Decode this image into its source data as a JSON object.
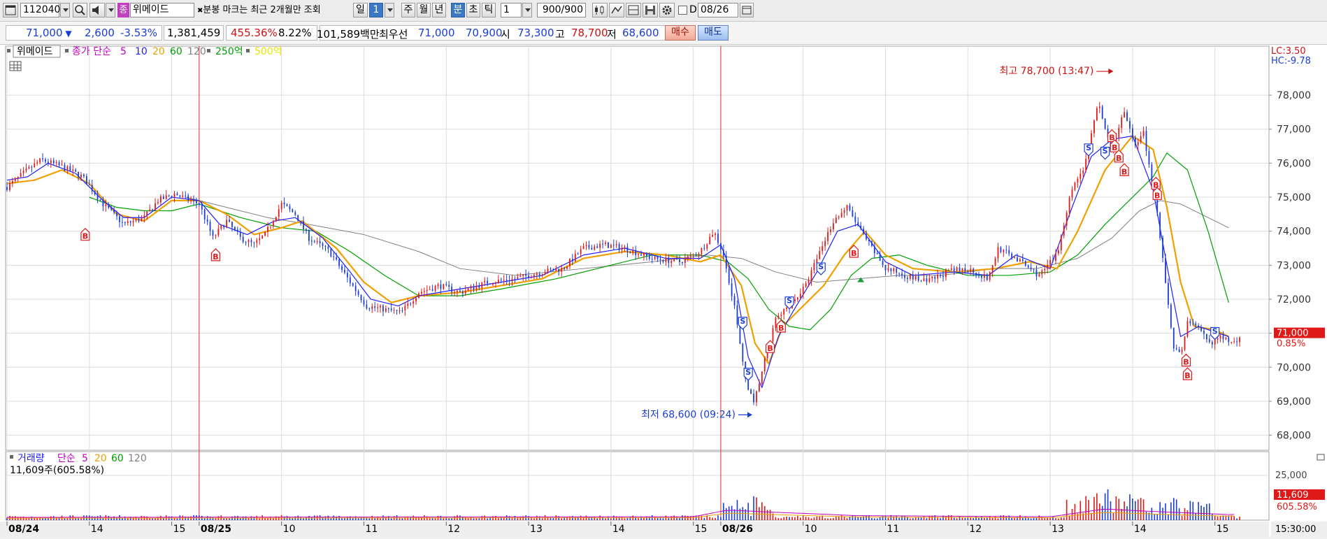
{
  "toolbar": {
    "code": "112040",
    "stock_badge": "종",
    "stock_name": "위메이드",
    "notice": "분봉 마크는 최근 2개월만 조회",
    "period_day": "일",
    "period_num": "1",
    "period_week": "주",
    "period_month": "월",
    "period_year": "년",
    "period_minute": "분",
    "period_second": "초",
    "period_tick": "틱",
    "interval": "1",
    "count": "900/900",
    "d_label": "D",
    "date": "08/26"
  },
  "price_bar": {
    "price": "71,000",
    "change": "2,600",
    "change_pct": "-3.53%",
    "volume": "1,381,459",
    "volume_ratio": "455.36%",
    "turnover": "8.22%",
    "amount": "101,589백만",
    "best_bid_label": "최우선",
    "ask": "71,000",
    "bid": "70,900",
    "open_label": "시",
    "open": "73,300",
    "high_label": "고",
    "high": "78,700",
    "low_label": "저",
    "low": "68,600",
    "buy_button": "매수",
    "sell_button": "매도"
  },
  "legend": {
    "name": "위메이드",
    "price_label": "종가 단순",
    "ma": [
      "5",
      "10",
      "20",
      "60",
      "120"
    ],
    "ma_colors": [
      "#d000d0",
      "#2020ff",
      "#f0a000",
      "#00a000",
      "#808080"
    ],
    "extra1": "250억",
    "extra1_color": "#00a000",
    "extra2": "500억",
    "extra2_color": "#e6e600"
  },
  "vol_legend": {
    "name": "거래량",
    "label": "단순",
    "ma": [
      "5",
      "20",
      "60",
      "120"
    ],
    "ma_colors": [
      "#d000d0",
      "#f0a000",
      "#00a000",
      "#808080"
    ],
    "value": "11,609주(605.58%)"
  },
  "annotations": {
    "high": "최고 78,700 (13:47)",
    "low": "최저 68,600 (09:24)"
  },
  "right_labels": {
    "lc": "LC:3.50",
    "hc": "HC:-9.78",
    "last_price": "71,000",
    "last_pct": "0.85%",
    "vol_last": "11,609",
    "vol_pct": "605.58%",
    "vol_tick": "25,000",
    "time": "15:30:00"
  },
  "chart_data": {
    "type": "candlestick",
    "title": "위메이드",
    "ylim": [
      67600,
      79400
    ],
    "y_ticks": [
      68000,
      69000,
      70000,
      71000,
      72000,
      73000,
      74000,
      75000,
      76000,
      77000,
      78000
    ],
    "y_tick_labels": [
      "68,000",
      "69,000",
      "70,000",
      "71,000",
      "72,000",
      "73,000",
      "74,000",
      "75,000",
      "76,000",
      "77,000",
      "78,000"
    ],
    "x_labels": [
      "08/24",
      "14",
      "15",
      "08/25",
      "10",
      "11",
      "12",
      "13",
      "14",
      "15",
      "08/26",
      "10",
      "11",
      "12",
      "13",
      "14",
      "15"
    ],
    "x_bold": [
      true,
      false,
      false,
      true,
      false,
      false,
      false,
      false,
      false,
      false,
      true,
      false,
      false,
      false,
      false,
      false,
      false
    ],
    "x_label_index": [
      0,
      60,
      120,
      140,
      200,
      260,
      320,
      380,
      440,
      500,
      520,
      580,
      640,
      700,
      760,
      820,
      880
    ],
    "day_separators_index": [
      140,
      520
    ],
    "total_bars": 900,
    "price_path": [
      [
        0,
        75300
      ],
      [
        15,
        75800
      ],
      [
        25,
        76100
      ],
      [
        40,
        75900
      ],
      [
        55,
        75600
      ],
      [
        70,
        74800
      ],
      [
        85,
        74200
      ],
      [
        100,
        74400
      ],
      [
        110,
        74900
      ],
      [
        122,
        75100
      ],
      [
        140,
        74800
      ],
      [
        150,
        73800
      ],
      [
        160,
        74300
      ],
      [
        170,
        73800
      ],
      [
        180,
        73600
      ],
      [
        188,
        73900
      ],
      [
        200,
        74800
      ],
      [
        210,
        74500
      ],
      [
        220,
        73800
      ],
      [
        235,
        73400
      ],
      [
        250,
        72500
      ],
      [
        262,
        71800
      ],
      [
        275,
        71700
      ],
      [
        287,
        71600
      ],
      [
        300,
        72200
      ],
      [
        315,
        72400
      ],
      [
        330,
        72200
      ],
      [
        350,
        72500
      ],
      [
        370,
        72600
      ],
      [
        390,
        72800
      ],
      [
        405,
        72900
      ],
      [
        420,
        73500
      ],
      [
        435,
        73600
      ],
      [
        450,
        73500
      ],
      [
        470,
        73200
      ],
      [
        490,
        73100
      ],
      [
        505,
        73400
      ],
      [
        515,
        74000
      ],
      [
        522,
        73300
      ],
      [
        530,
        71800
      ],
      [
        537,
        69800
      ],
      [
        544,
        68900
      ],
      [
        552,
        70200
      ],
      [
        560,
        71400
      ],
      [
        572,
        71900
      ],
      [
        582,
        72400
      ],
      [
        592,
        73400
      ],
      [
        602,
        74300
      ],
      [
        612,
        74700
      ],
      [
        625,
        73800
      ],
      [
        640,
        72900
      ],
      [
        655,
        72700
      ],
      [
        670,
        72500
      ],
      [
        685,
        72800
      ],
      [
        700,
        72900
      ],
      [
        715,
        72600
      ],
      [
        722,
        73500
      ],
      [
        735,
        73200
      ],
      [
        752,
        72700
      ],
      [
        765,
        73300
      ],
      [
        775,
        75200
      ],
      [
        785,
        75900
      ],
      [
        795,
        77800
      ],
      [
        805,
        76200
      ],
      [
        813,
        77600
      ],
      [
        822,
        76500
      ],
      [
        828,
        76900
      ],
      [
        838,
        74500
      ],
      [
        844,
        72500
      ],
      [
        850,
        70600
      ],
      [
        855,
        70300
      ],
      [
        860,
        71400
      ],
      [
        868,
        71100
      ],
      [
        876,
        70700
      ],
      [
        884,
        70900
      ],
      [
        890,
        70800
      ]
    ],
    "ma5_path": [
      [
        0,
        75500
      ],
      [
        15,
        75600
      ],
      [
        30,
        76000
      ],
      [
        50,
        75700
      ],
      [
        70,
        74900
      ],
      [
        85,
        74400
      ],
      [
        100,
        74400
      ],
      [
        120,
        75000
      ],
      [
        140,
        74900
      ],
      [
        155,
        74200
      ],
      [
        175,
        73900
      ],
      [
        195,
        74300
      ],
      [
        210,
        74400
      ],
      [
        230,
        73800
      ],
      [
        250,
        72800
      ],
      [
        265,
        72000
      ],
      [
        285,
        71800
      ],
      [
        300,
        72100
      ],
      [
        330,
        72300
      ],
      [
        360,
        72500
      ],
      [
        390,
        72700
      ],
      [
        420,
        73300
      ],
      [
        450,
        73500
      ],
      [
        480,
        73200
      ],
      [
        505,
        73200
      ],
      [
        520,
        73600
      ],
      [
        530,
        72600
      ],
      [
        540,
        70300
      ],
      [
        550,
        69400
      ],
      [
        562,
        70900
      ],
      [
        575,
        71800
      ],
      [
        590,
        72800
      ],
      [
        605,
        74000
      ],
      [
        620,
        74200
      ],
      [
        640,
        73100
      ],
      [
        660,
        72700
      ],
      [
        690,
        72800
      ],
      [
        715,
        72700
      ],
      [
        735,
        73300
      ],
      [
        760,
        72900
      ],
      [
        775,
        74600
      ],
      [
        790,
        76200
      ],
      [
        805,
        76700
      ],
      [
        820,
        76800
      ],
      [
        835,
        75200
      ],
      [
        845,
        73000
      ],
      [
        855,
        70900
      ],
      [
        868,
        71200
      ],
      [
        890,
        70900
      ]
    ],
    "ma20_path": [
      [
        0,
        75400
      ],
      [
        20,
        75500
      ],
      [
        40,
        75800
      ],
      [
        60,
        75400
      ],
      [
        80,
        74500
      ],
      [
        100,
        74300
      ],
      [
        120,
        74900
      ],
      [
        140,
        74900
      ],
      [
        160,
        74500
      ],
      [
        180,
        73900
      ],
      [
        200,
        74100
      ],
      [
        215,
        74300
      ],
      [
        240,
        73500
      ],
      [
        260,
        72500
      ],
      [
        280,
        71900
      ],
      [
        300,
        72100
      ],
      [
        330,
        72200
      ],
      [
        360,
        72400
      ],
      [
        390,
        72600
      ],
      [
        420,
        73200
      ],
      [
        450,
        73400
      ],
      [
        480,
        73300
      ],
      [
        505,
        73100
      ],
      [
        520,
        73300
      ],
      [
        535,
        72400
      ],
      [
        545,
        70700
      ],
      [
        555,
        70100
      ],
      [
        565,
        71200
      ],
      [
        580,
        71800
      ],
      [
        595,
        72400
      ],
      [
        610,
        73300
      ],
      [
        625,
        74000
      ],
      [
        640,
        73300
      ],
      [
        660,
        72900
      ],
      [
        690,
        72800
      ],
      [
        720,
        72900
      ],
      [
        745,
        73100
      ],
      [
        765,
        72900
      ],
      [
        780,
        74000
      ],
      [
        800,
        75800
      ],
      [
        820,
        76800
      ],
      [
        835,
        76400
      ],
      [
        845,
        74700
      ],
      [
        855,
        72500
      ],
      [
        865,
        71200
      ],
      [
        880,
        71100
      ],
      [
        890,
        70900
      ]
    ],
    "ma60_path": [
      [
        60,
        75000
      ],
      [
        80,
        74700
      ],
      [
        100,
        74600
      ],
      [
        120,
        74600
      ],
      [
        140,
        74800
      ],
      [
        170,
        74400
      ],
      [
        200,
        74100
      ],
      [
        225,
        74000
      ],
      [
        250,
        73400
      ],
      [
        275,
        72700
      ],
      [
        300,
        72100
      ],
      [
        330,
        72100
      ],
      [
        360,
        72300
      ],
      [
        400,
        72600
      ],
      [
        440,
        73000
      ],
      [
        470,
        73300
      ],
      [
        505,
        73300
      ],
      [
        525,
        73100
      ],
      [
        540,
        72600
      ],
      [
        555,
        71700
      ],
      [
        570,
        71200
      ],
      [
        585,
        71100
      ],
      [
        600,
        71700
      ],
      [
        615,
        72700
      ],
      [
        630,
        73200
      ],
      [
        650,
        73300
      ],
      [
        670,
        73000
      ],
      [
        700,
        72700
      ],
      [
        730,
        72700
      ],
      [
        760,
        72800
      ],
      [
        780,
        73300
      ],
      [
        800,
        74200
      ],
      [
        820,
        75000
      ],
      [
        835,
        75600
      ],
      [
        845,
        76300
      ],
      [
        860,
        75800
      ],
      [
        875,
        74000
      ],
      [
        890,
        71900
      ]
    ],
    "ma120_path": [
      [
        130,
        75000
      ],
      [
        160,
        74700
      ],
      [
        190,
        74400
      ],
      [
        220,
        74200
      ],
      [
        260,
        73900
      ],
      [
        300,
        73400
      ],
      [
        330,
        72900
      ],
      [
        370,
        72700
      ],
      [
        420,
        72900
      ],
      [
        470,
        73100
      ],
      [
        510,
        73300
      ],
      [
        535,
        73200
      ],
      [
        560,
        72800
      ],
      [
        590,
        72500
      ],
      [
        620,
        72600
      ],
      [
        650,
        72700
      ],
      [
        680,
        72700
      ],
      [
        720,
        72900
      ],
      [
        750,
        72900
      ],
      [
        780,
        73200
      ],
      [
        805,
        73800
      ],
      [
        825,
        74600
      ],
      [
        840,
        74900
      ],
      [
        855,
        74800
      ],
      [
        870,
        74500
      ],
      [
        890,
        74100
      ]
    ],
    "signals": [
      {
        "i": 57,
        "p": 74000,
        "t": "B"
      },
      {
        "i": 152,
        "p": 73400,
        "t": "B"
      },
      {
        "i": 536,
        "p": 71200,
        "t": "S"
      },
      {
        "i": 540,
        "p": 69700,
        "t": "S"
      },
      {
        "i": 556,
        "p": 70700,
        "t": "B"
      },
      {
        "i": 564,
        "p": 71300,
        "t": "B"
      },
      {
        "i": 570,
        "p": 71800,
        "t": "S"
      },
      {
        "i": 593,
        "p": 72800,
        "t": "S"
      },
      {
        "i": 617,
        "p": 73500,
        "t": "B"
      },
      {
        "i": 788,
        "p": 76300,
        "t": "S"
      },
      {
        "i": 800,
        "p": 76200,
        "t": "S"
      },
      {
        "i": 805,
        "p": 76900,
        "t": "B"
      },
      {
        "i": 807,
        "p": 76600,
        "t": "B"
      },
      {
        "i": 810,
        "p": 76300,
        "t": "B"
      },
      {
        "i": 814,
        "p": 75900,
        "t": "B"
      },
      {
        "i": 837,
        "p": 75500,
        "t": "B"
      },
      {
        "i": 838,
        "p": 75200,
        "t": "B"
      },
      {
        "i": 859,
        "p": 70300,
        "t": "B"
      },
      {
        "i": 860,
        "p": 69900,
        "t": "B"
      },
      {
        "i": 880,
        "p": 70900,
        "t": "S"
      }
    ],
    "high_point": {
      "i": 807,
      "p": 78700
    },
    "low_point": {
      "i": 544,
      "p": 68600
    },
    "volume_ylim": [
      0,
      28000
    ],
    "volume_ticks": [
      25000
    ]
  }
}
